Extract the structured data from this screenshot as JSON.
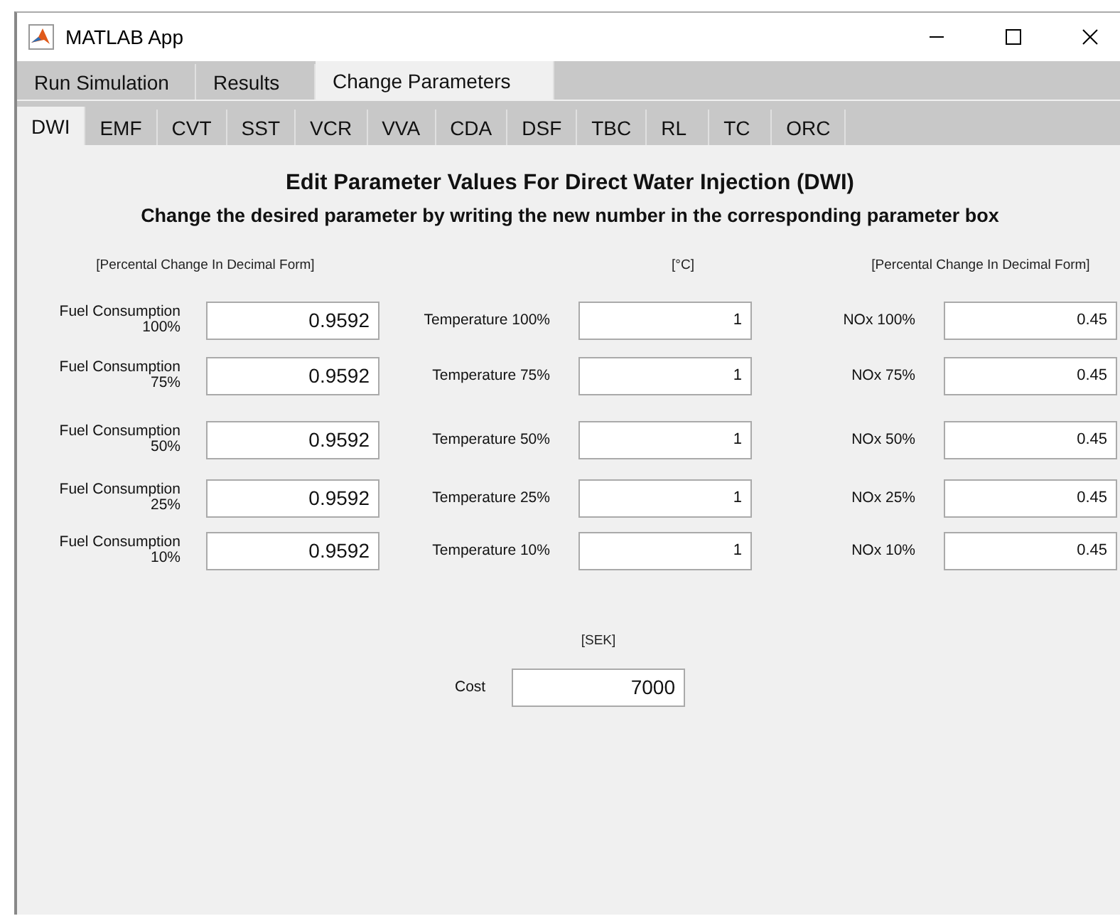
{
  "window": {
    "title": "MATLAB App"
  },
  "tabs": [
    {
      "label": "Run Simulation",
      "selected": false
    },
    {
      "label": "Results",
      "selected": false
    },
    {
      "label": "Change Parameters",
      "selected": true
    }
  ],
  "subtabs": [
    {
      "label": "DWI",
      "selected": true
    },
    {
      "label": "EMF",
      "selected": false
    },
    {
      "label": "CVT",
      "selected": false
    },
    {
      "label": "SST",
      "selected": false
    },
    {
      "label": "VCR",
      "selected": false
    },
    {
      "label": "VVA",
      "selected": false
    },
    {
      "label": "CDA",
      "selected": false
    },
    {
      "label": "DSF",
      "selected": false
    },
    {
      "label": "TBC",
      "selected": false
    },
    {
      "label": "RL",
      "selected": false
    },
    {
      "label": "TC",
      "selected": false
    },
    {
      "label": "ORC",
      "selected": false
    }
  ],
  "heading": "Edit Parameter Values For Direct Water Injection (DWI)",
  "instruction": "Change the desired parameter by writing the new number in the corresponding parameter box",
  "columns": [
    {
      "unit": "[Percental Change In Decimal Form]",
      "fields": [
        {
          "label": "Fuel Consumption 100%",
          "value": "0.9592"
        },
        {
          "label": "Fuel Consumption 75%",
          "value": "0.9592"
        },
        {
          "label": "Fuel Consumption 50%",
          "value": "0.9592"
        },
        {
          "label": "Fuel Consumption 25%",
          "value": "0.9592"
        },
        {
          "label": "Fuel Consumption 10%",
          "value": "0.9592"
        }
      ]
    },
    {
      "unit": "[°C]",
      "fields": [
        {
          "label": "Temperature 100%",
          "value": "1"
        },
        {
          "label": "Temperature 75%",
          "value": "1"
        },
        {
          "label": "Temperature 50%",
          "value": "1"
        },
        {
          "label": "Temperature 25%",
          "value": "1"
        },
        {
          "label": "Temperature 10%",
          "value": "1"
        }
      ]
    },
    {
      "unit": "[Percental Change In Decimal Form]",
      "fields": [
        {
          "label": "NOx 100%",
          "value": "0.45"
        },
        {
          "label": "NOx 75%",
          "value": "0.45"
        },
        {
          "label": "NOx 50%",
          "value": "0.45"
        },
        {
          "label": "NOx 25%",
          "value": "0.45"
        },
        {
          "label": "NOx 10%",
          "value": "0.45"
        }
      ]
    }
  ],
  "cost": {
    "unit": "[SEK]",
    "label": "Cost",
    "value": "7000"
  }
}
